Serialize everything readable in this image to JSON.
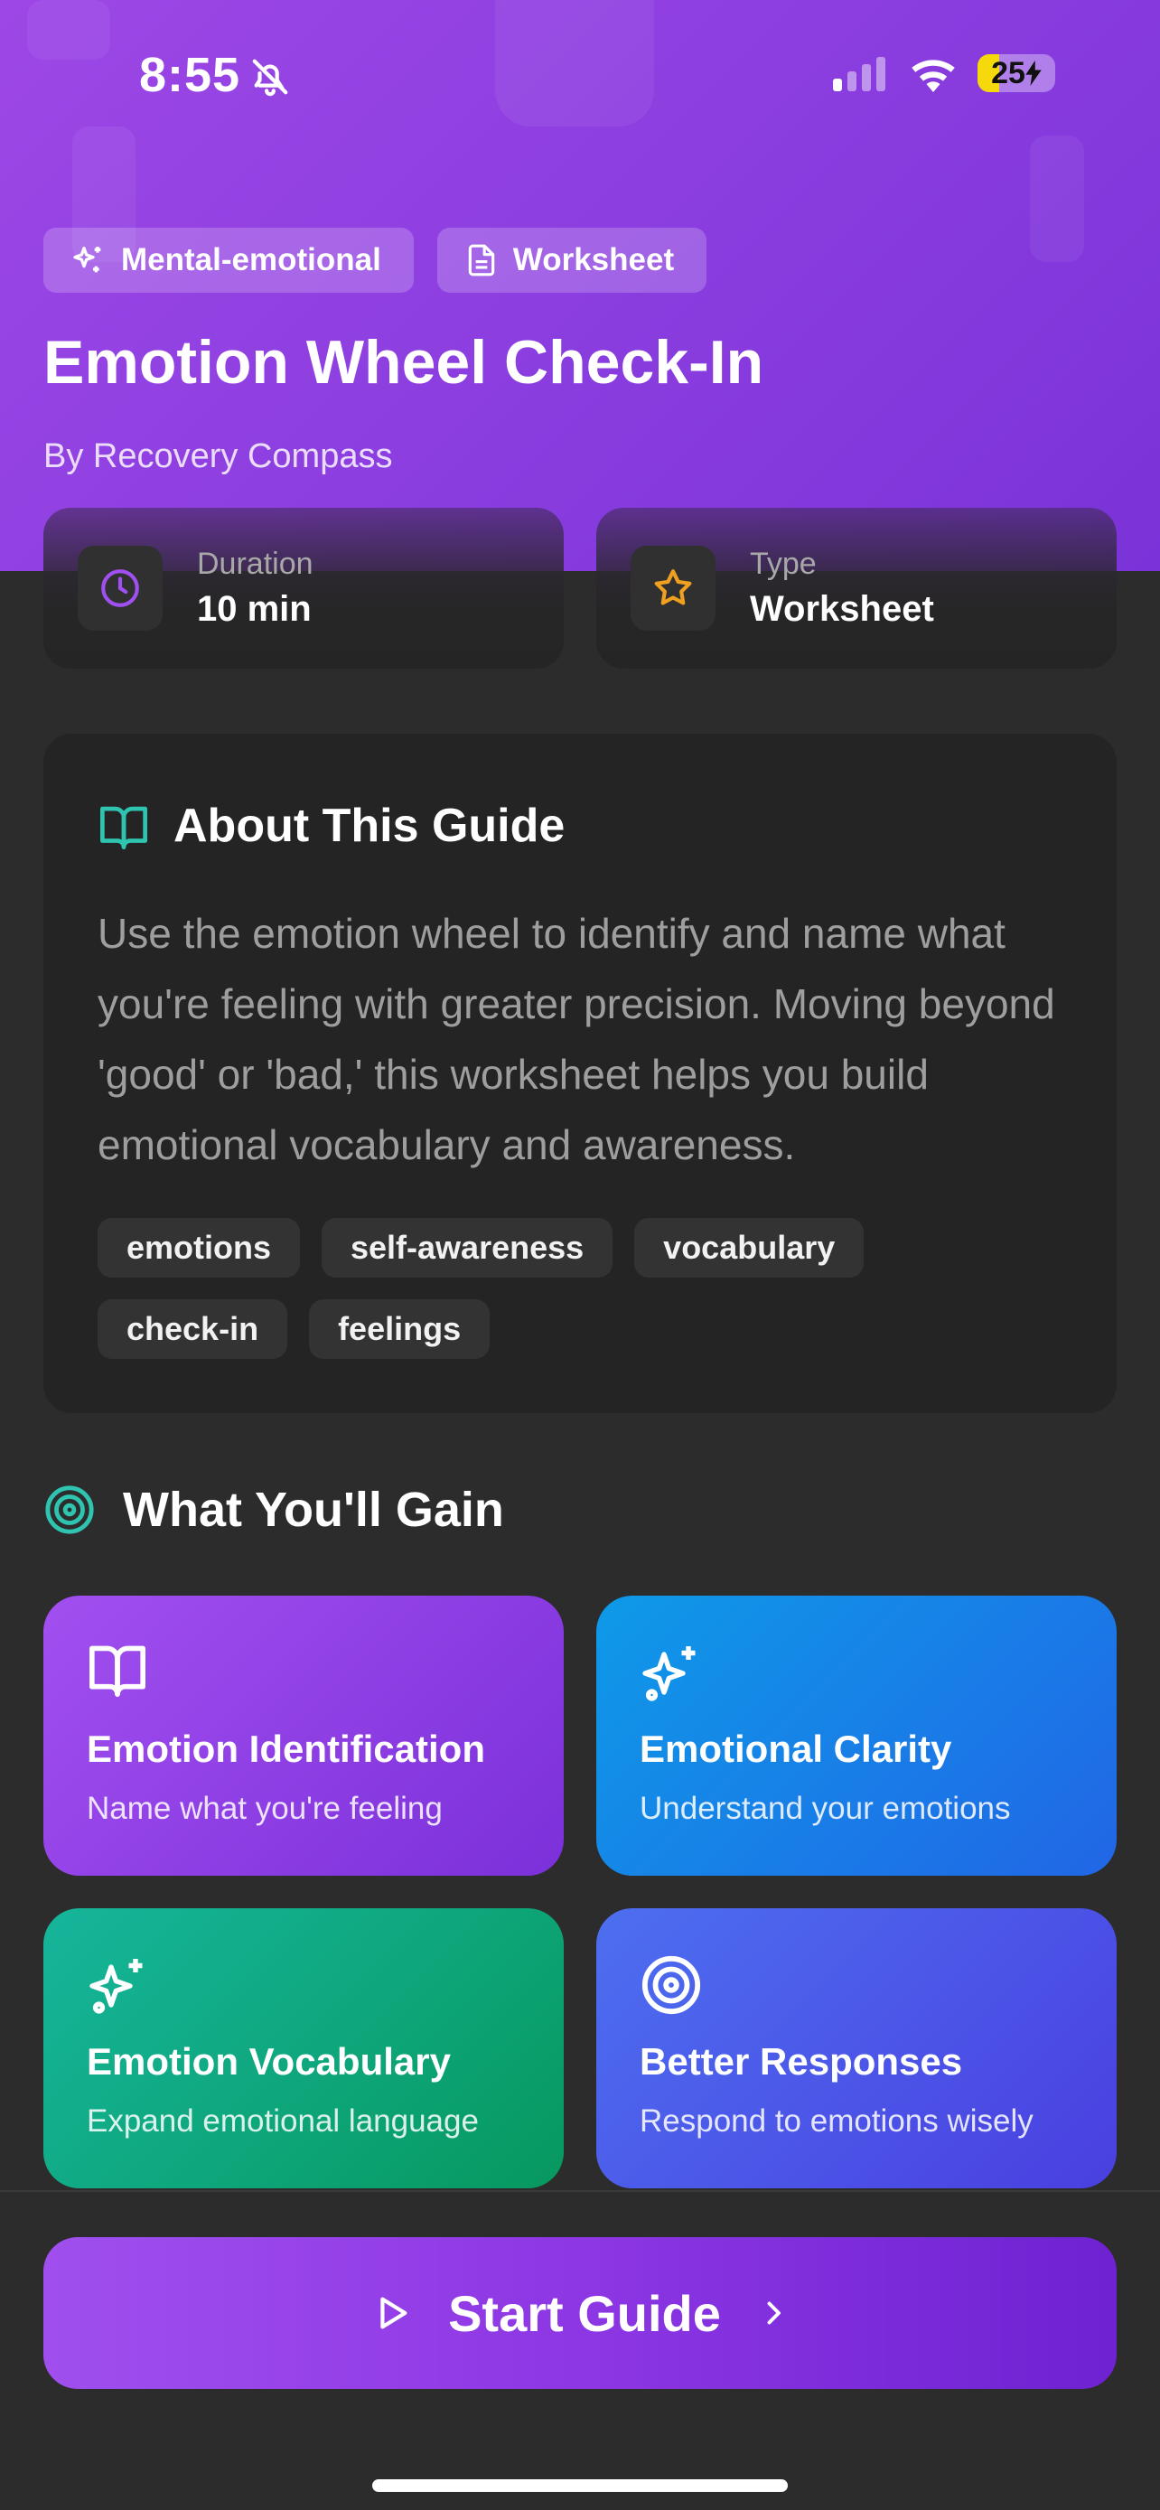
{
  "status_bar": {
    "time": "8:55",
    "battery": "25"
  },
  "hero": {
    "chips": [
      {
        "icon": "sparkles-icon",
        "label": "Mental-emotional"
      },
      {
        "icon": "document-icon",
        "label": "Worksheet"
      }
    ],
    "title": "Emotion Wheel Check-In",
    "byline": "By Recovery Compass"
  },
  "stats": [
    {
      "icon": "clock-icon",
      "label": "Duration",
      "value": "10 min"
    },
    {
      "icon": "star-icon",
      "label": "Type",
      "value": "Worksheet"
    }
  ],
  "about": {
    "icon": "book-open-icon",
    "title": "About This Guide",
    "description": "Use the emotion wheel to identify and name what you're feeling with greater precision. Moving beyond 'good' or 'bad,' this worksheet helps you build emotional vocabulary and awareness.",
    "tags": [
      "emotions",
      "self-awareness",
      "vocabulary",
      "check-in",
      "feelings"
    ]
  },
  "gains": {
    "icon": "target-icon",
    "title": "What You'll Gain",
    "cards": [
      {
        "icon": "book-open-icon",
        "title": "Emotion Identification",
        "subtitle": "Name what you're feeling",
        "gradient": [
          "#a24ff0",
          "#7b30d9"
        ]
      },
      {
        "icon": "sparkles-icon",
        "title": "Emotional Clarity",
        "subtitle": "Understand your emotions",
        "gradient": [
          "#0e9ae8",
          "#2166e6"
        ]
      },
      {
        "icon": "sparkles-icon",
        "title": "Emotion Vocabulary",
        "subtitle": "Expand emotional language",
        "gradient": [
          "#16b69c",
          "#07985f"
        ]
      },
      {
        "icon": "target-icon",
        "title": "Better Responses",
        "subtitle": "Respond to emotions wisely",
        "gradient": [
          "#4d6ff0",
          "#4a3fe0"
        ]
      }
    ]
  },
  "footer": {
    "start_label": "Start Guide"
  },
  "colors": {
    "accent_purple": "#9d47e6",
    "teal": "#2ec4b0",
    "star": "#f0a020"
  }
}
